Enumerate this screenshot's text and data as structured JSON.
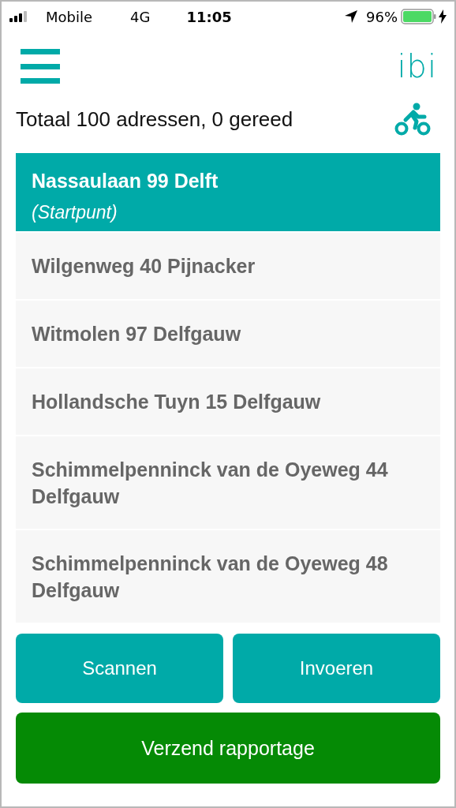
{
  "status_bar": {
    "carrier": "Mobile",
    "network": "4G",
    "time": "11:05",
    "battery": "96%"
  },
  "header": {
    "logo": "ibi"
  },
  "summary": "Totaal 100 adressen, 0 gereed",
  "addresses": [
    {
      "name": "Nassaulaan 99 Delft",
      "note": "(Startpunt)",
      "selected": true
    },
    {
      "name": "Wilgenweg 40 Pijnacker",
      "selected": false
    },
    {
      "name": "Witmolen 97 Delfgauw",
      "selected": false
    },
    {
      "name": "Hollandsche Tuyn 15 Delfgauw",
      "selected": false
    },
    {
      "name": "Schimmelpenninck van de Oyeweg 44 Delfgauw",
      "selected": false
    },
    {
      "name": "Schimmelpenninck van de Oyeweg 48 Delfgauw",
      "selected": false
    }
  ],
  "actions": [
    {
      "label": "Scannen"
    },
    {
      "label": "Invoeren"
    }
  ],
  "submit": {
    "label": "Verzend rapportage"
  }
}
